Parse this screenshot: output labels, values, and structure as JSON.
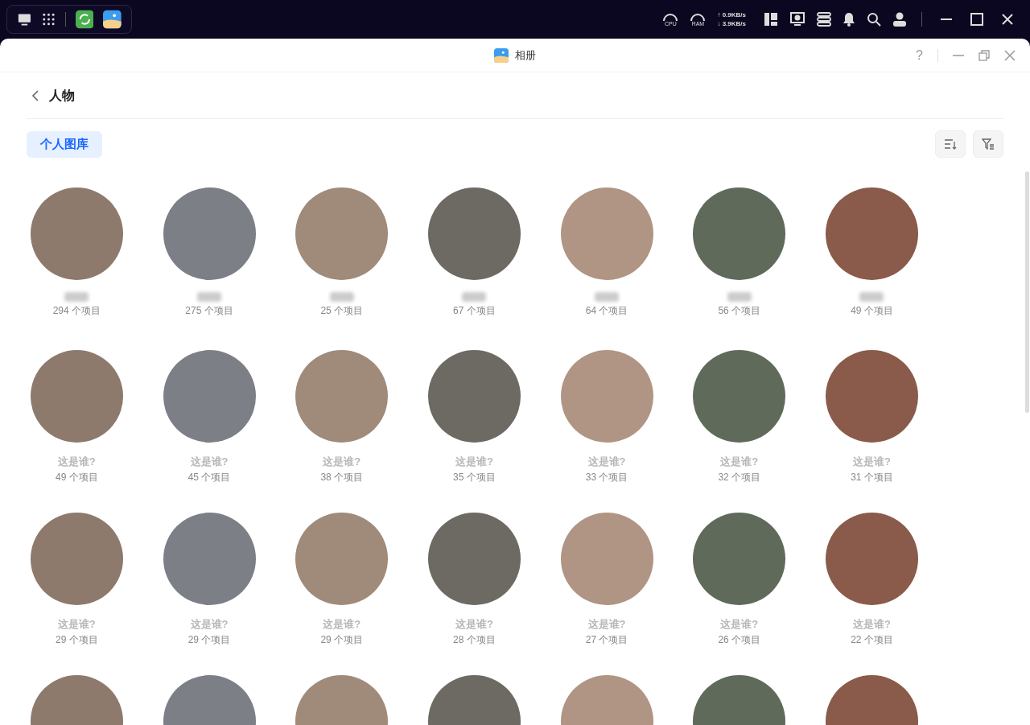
{
  "topbar": {
    "network": {
      "upload": "↑ 0.9KB/s",
      "download": "↓ 3.9KB/s"
    },
    "cpu_label": "CPU",
    "ram_label": "RAM"
  },
  "window": {
    "title": "相册",
    "help": "?"
  },
  "header": {
    "title": "人物"
  },
  "tabs": [
    {
      "label": "个人图库",
      "selected": true
    }
  ],
  "people": [
    {
      "name_hidden": true,
      "count": "294 个项目"
    },
    {
      "name_hidden": true,
      "count": "275 个项目"
    },
    {
      "name_hidden": true,
      "count": "25 个项目"
    },
    {
      "name_hidden": true,
      "count": "67 个项目"
    },
    {
      "name_hidden": true,
      "count": "64 个项目"
    },
    {
      "name_hidden": true,
      "count": "56 个项目"
    },
    {
      "name_hidden": true,
      "count": "49 个项目"
    },
    {
      "name_hidden": false,
      "name": "这是谁?",
      "count": "49 个项目"
    },
    {
      "name_hidden": false,
      "name": "这是谁?",
      "count": "45 个项目"
    },
    {
      "name_hidden": false,
      "name": "这是谁?",
      "count": "38 个项目"
    },
    {
      "name_hidden": false,
      "name": "这是谁?",
      "count": "35 个项目"
    },
    {
      "name_hidden": false,
      "name": "这是谁?",
      "count": "33 个项目"
    },
    {
      "name_hidden": false,
      "name": "这是谁?",
      "count": "32 个项目"
    },
    {
      "name_hidden": false,
      "name": "这是谁?",
      "count": "31 个项目"
    },
    {
      "name_hidden": false,
      "name": "这是谁?",
      "count": "29 个项目"
    },
    {
      "name_hidden": false,
      "name": "这是谁?",
      "count": "29 个项目"
    },
    {
      "name_hidden": false,
      "name": "这是谁?",
      "count": "29 个项目"
    },
    {
      "name_hidden": false,
      "name": "这是谁?",
      "count": "28 个项目"
    },
    {
      "name_hidden": false,
      "name": "这是谁?",
      "count": "27 个项目"
    },
    {
      "name_hidden": false,
      "name": "这是谁?",
      "count": "26 个项目"
    },
    {
      "name_hidden": false,
      "name": "这是谁?",
      "count": "22 个项目"
    },
    {
      "name_hidden": false
    },
    {
      "name_hidden": false
    },
    {
      "name_hidden": false
    },
    {
      "name_hidden": false
    },
    {
      "name_hidden": false
    },
    {
      "name_hidden": false
    },
    {
      "name_hidden": false
    }
  ]
}
